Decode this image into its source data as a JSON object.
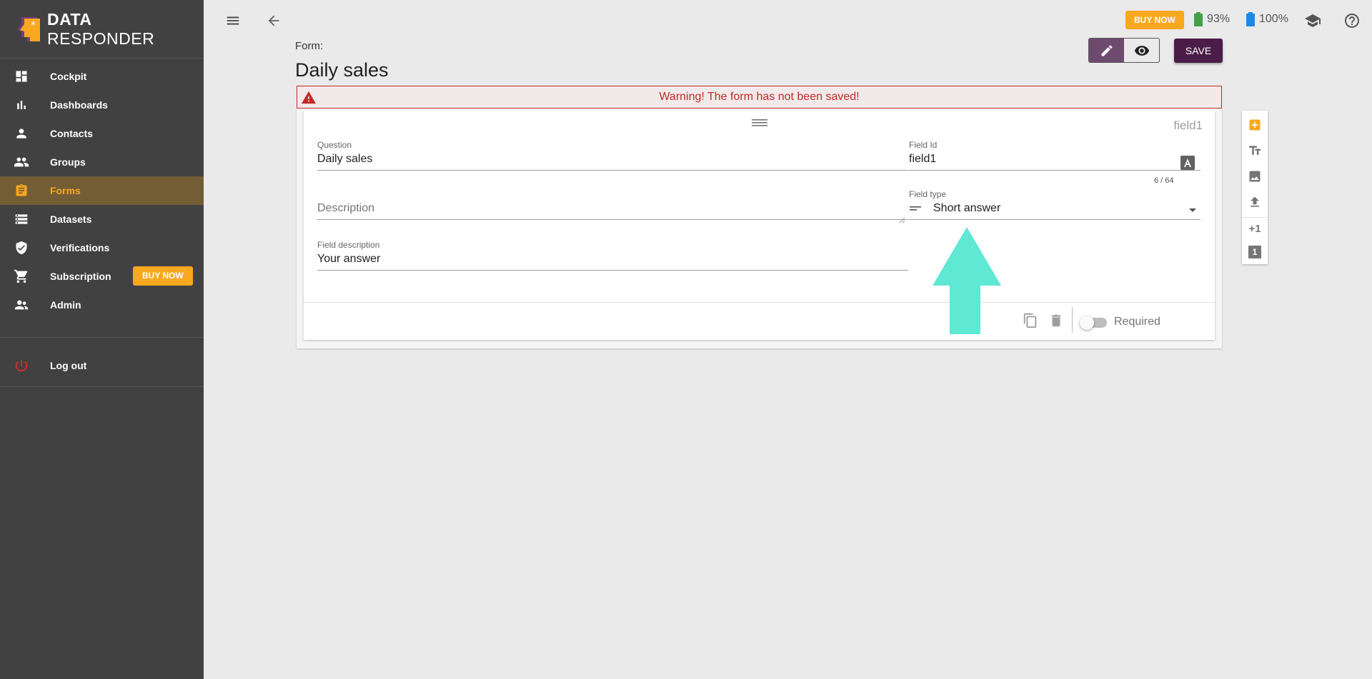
{
  "sidebar": {
    "logo": {
      "bold": "DATA",
      "light": "RESPONDER"
    },
    "items": [
      {
        "label": "Cockpit",
        "icon": "dashboard-icon"
      },
      {
        "label": "Dashboards",
        "icon": "bar-chart-icon"
      },
      {
        "label": "Contacts",
        "icon": "person-icon"
      },
      {
        "label": "Groups",
        "icon": "people-icon"
      },
      {
        "label": "Forms",
        "icon": "clipboard-icon",
        "active": true
      },
      {
        "label": "Datasets",
        "icon": "list-icon"
      },
      {
        "label": "Verifications",
        "icon": "shield-check-icon"
      },
      {
        "label": "Subscription",
        "icon": "cart-icon",
        "badge": "BUY NOW"
      },
      {
        "label": "Admin",
        "icon": "admin-icon"
      }
    ],
    "logout": "Log out"
  },
  "topbar": {
    "buy_now": "BUY NOW",
    "battery1": "93%",
    "battery2": "100%"
  },
  "form": {
    "label": "Form:",
    "title": "Daily sales",
    "save": "SAVE",
    "warning": "Warning! The form has not been saved!"
  },
  "field": {
    "tag": "field1",
    "question_label": "Question",
    "question_value": "Daily sales",
    "field_id_label": "Field Id",
    "field_id_value": "field1",
    "counter": "6 / 64",
    "description_placeholder": "Description",
    "field_type_label": "Field type",
    "field_type_value": "Short answer",
    "field_desc_label": "Field description",
    "field_desc_value": "Your answer",
    "required_label": "Required"
  },
  "tools": {
    "plus_one": "+1",
    "number": "1"
  },
  "colors": {
    "sidebar": "#414141",
    "accent": "#f8a81f",
    "primary": "#4a1c47",
    "warning": "#c62828",
    "arrow": "#5fe8d4"
  }
}
